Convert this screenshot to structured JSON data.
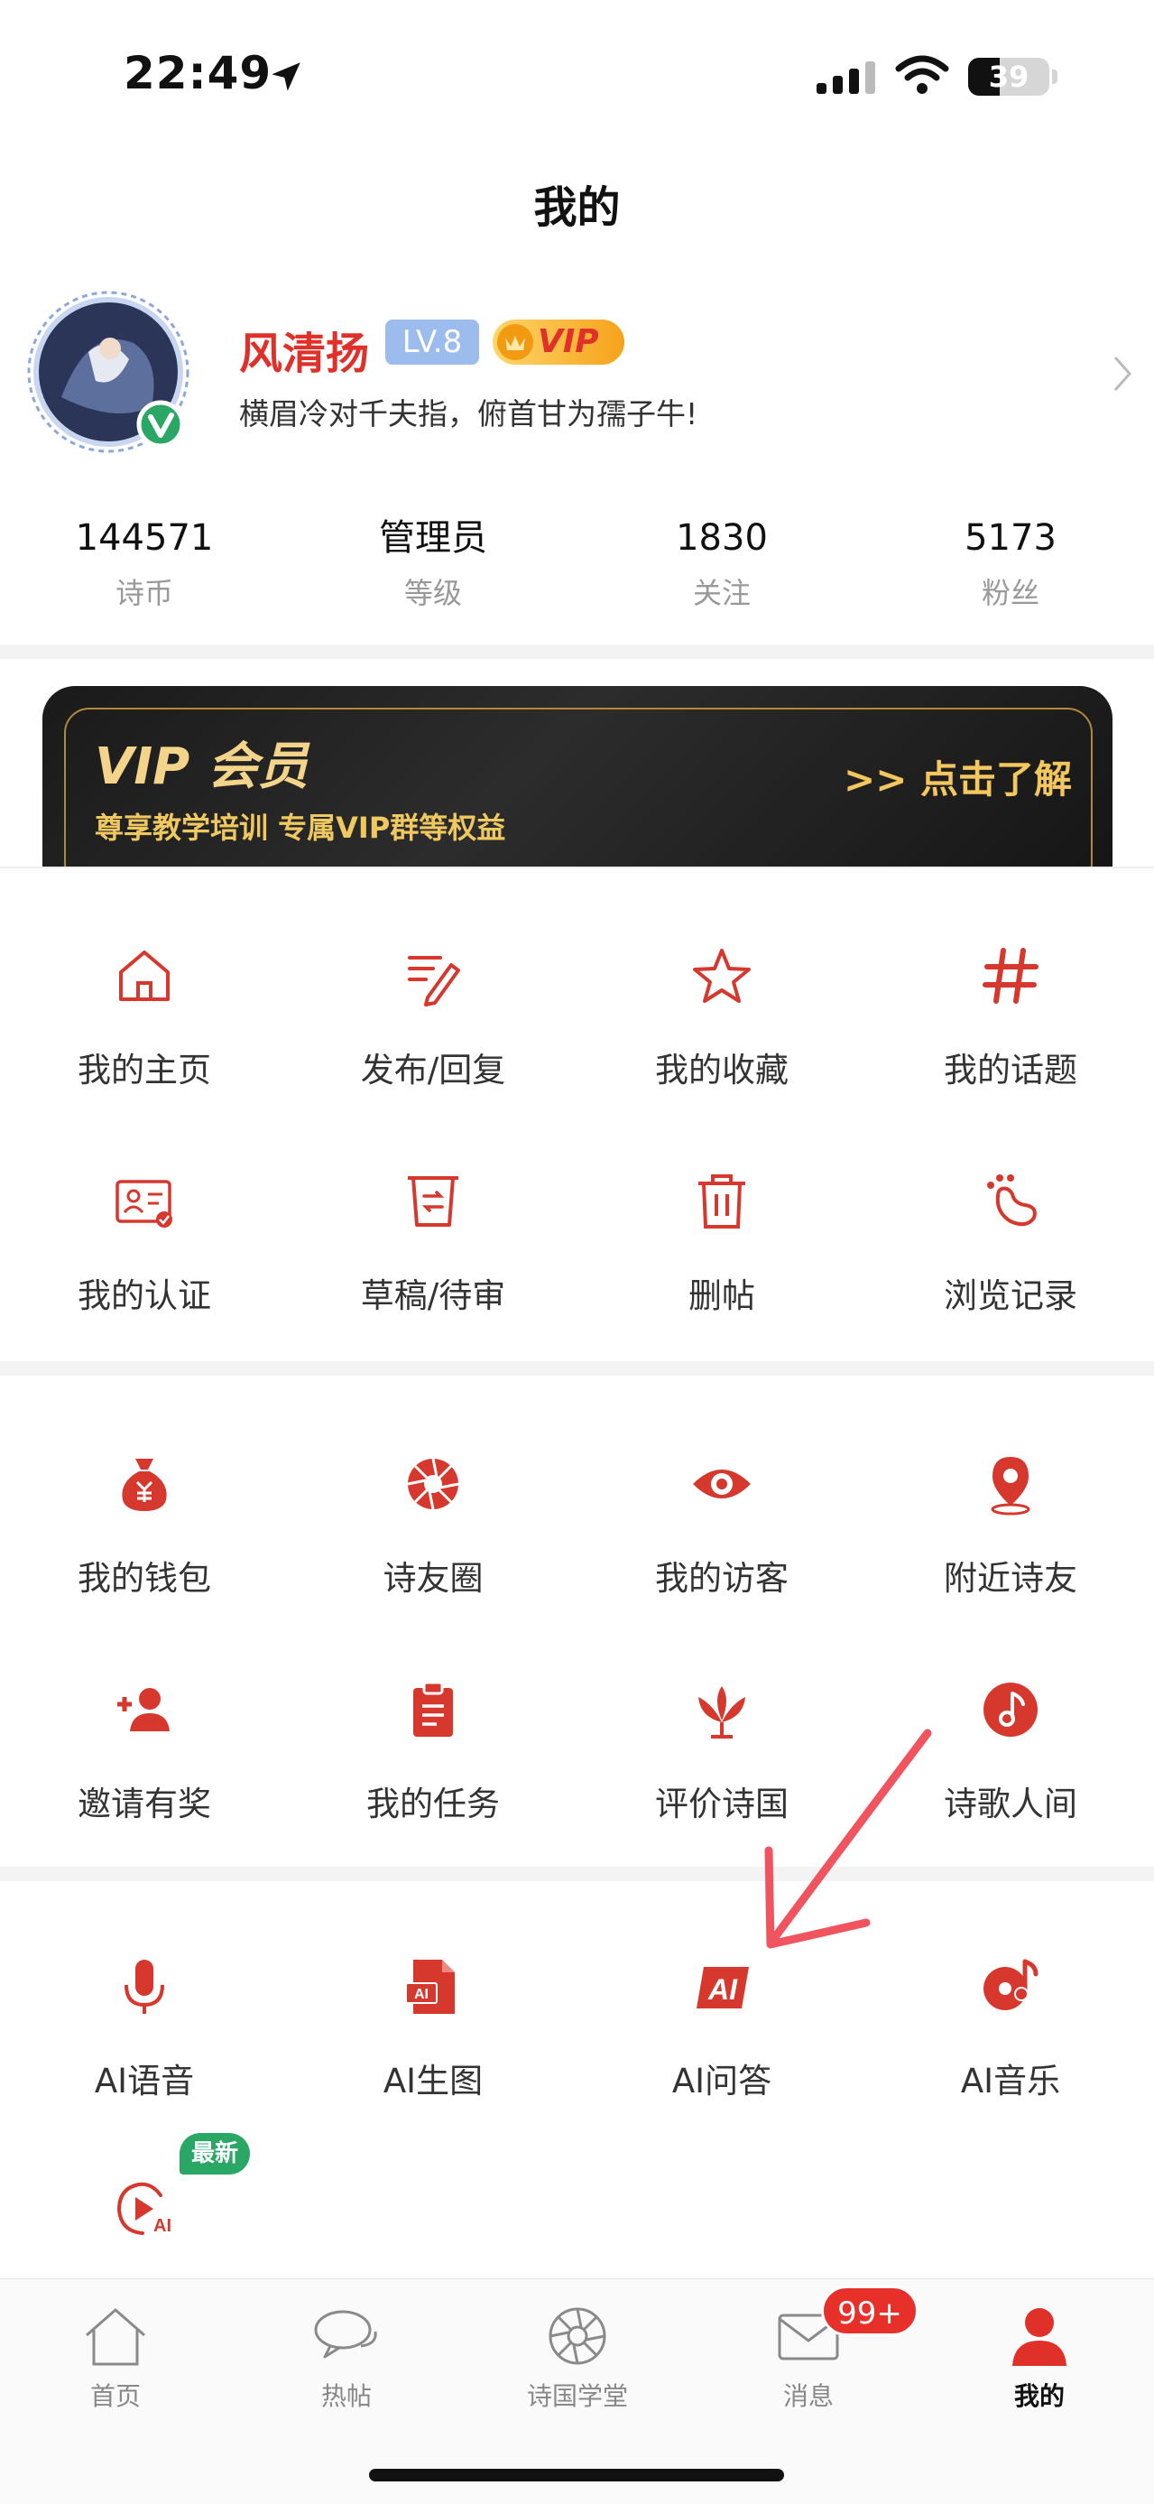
{
  "status_bar": {
    "time": "22:49",
    "battery": "39",
    "battery_level": 0.39
  },
  "header": {
    "title": "我的"
  },
  "profile": {
    "name": "风清扬",
    "level": "LV.8",
    "vip_label": "VIP",
    "signature": "横眉冷对千夫指，俯首甘为孺子牛!"
  },
  "stats": [
    {
      "value": "144571",
      "label": "诗币"
    },
    {
      "value": "管理员",
      "label": "等级"
    },
    {
      "value": "1830",
      "label": "关注"
    },
    {
      "value": "5173",
      "label": "粉丝"
    }
  ],
  "vip_banner": {
    "title": "VIP 会员",
    "subtitle": "尊享教学培训 专属VIP群等权益",
    "cta": ">> 点击了解"
  },
  "section1": [
    {
      "label": "我的主页",
      "icon": "home-outline-icon"
    },
    {
      "label": "发布/回复",
      "icon": "edit-icon"
    },
    {
      "label": "我的收藏",
      "icon": "star-icon"
    },
    {
      "label": "我的话题",
      "icon": "hashtag-icon"
    },
    {
      "label": "我的认证",
      "icon": "id-card-icon"
    },
    {
      "label": "草稿/待审",
      "icon": "draft-icon"
    },
    {
      "label": "删帖",
      "icon": "trash-icon"
    },
    {
      "label": "浏览记录",
      "icon": "footprint-icon"
    }
  ],
  "section2": [
    {
      "label": "我的钱包",
      "icon": "money-bag-icon"
    },
    {
      "label": "诗友圈",
      "icon": "aperture-icon"
    },
    {
      "label": "我的访客",
      "icon": "eye-icon"
    },
    {
      "label": "附近诗友",
      "icon": "location-pin-icon"
    },
    {
      "label": "邀请有奖",
      "icon": "add-user-icon"
    },
    {
      "label": "我的任务",
      "icon": "clipboard-icon"
    },
    {
      "label": "评价诗国",
      "icon": "lotus-icon"
    },
    {
      "label": "诗歌人间",
      "icon": "music-note-icon"
    }
  ],
  "section3": [
    {
      "label": "AI语音",
      "icon": "microphone-icon"
    },
    {
      "label": "AI生图",
      "icon": "ai-image-icon"
    },
    {
      "label": "AI问答",
      "icon": "ai-qa-icon"
    },
    {
      "label": "AI音乐",
      "icon": "ai-music-icon"
    },
    {
      "label": "",
      "icon": "ai-video-icon",
      "badge": "最新"
    }
  ],
  "tab_bar": [
    {
      "label": "首页",
      "icon": "home-tab-icon"
    },
    {
      "label": "热帖",
      "icon": "chat-bubbles-icon"
    },
    {
      "label": "诗国学堂",
      "icon": "aperture-tab-icon"
    },
    {
      "label": "消息",
      "icon": "envelope-icon",
      "badge": "99+"
    },
    {
      "label": "我的",
      "icon": "person-icon",
      "active": true
    }
  ],
  "colors": {
    "accent": "#e0302a",
    "vip_gold": "#f3c75e",
    "badge_green": "#2aa765"
  }
}
